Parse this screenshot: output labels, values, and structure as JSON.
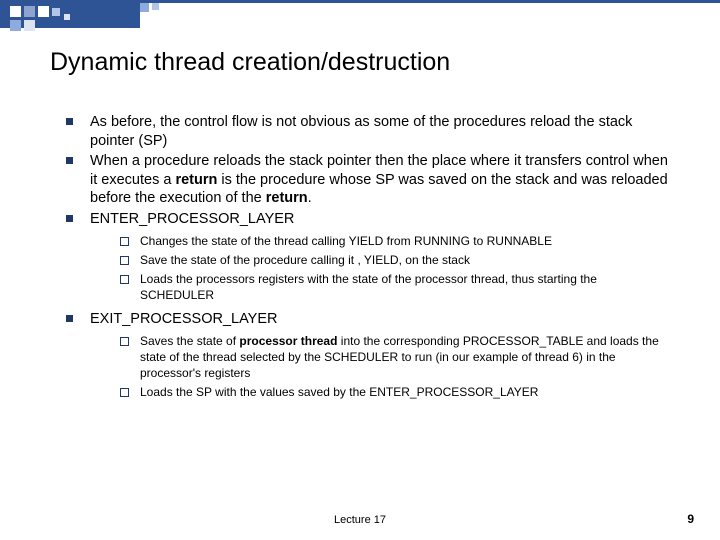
{
  "title": "Dynamic thread creation/destruction",
  "b1": "As before, the control flow is not obvious as some of the procedures reload the stack pointer (SP)",
  "b2a": "When a procedure reloads the stack pointer then the place where it transfers control when it executes a ",
  "b2b": "return",
  "b2c": "  is the procedure whose SP was saved on the stack and was reloaded before the execution of the ",
  "b2d": "return",
  "b2e": ".",
  "b3": "ENTER_PROCESSOR_LAYER",
  "s1": "Changes the state of the thread calling YIELD  from RUNNING to RUNNABLE",
  "s2": "Save the state of the procedure calling it , YIELD, on the stack",
  "s3": "Loads the processors registers with the state of the processor thread, thus starting the SCHEDULER",
  "b4": "EXIT_PROCESSOR_LAYER",
  "s4a": "Saves the state of ",
  "s4b": "processor thread",
  "s4c": " into the corresponding PROCESSOR_TABLE and loads the state of the thread selected by the SCHEDULER to run (in our example of thread 6) in the processor's registers",
  "s5": "Loads the SP with the values saved by the ENTER_PROCESSOR_LAYER",
  "lecture": "Lecture 17",
  "page": "9"
}
